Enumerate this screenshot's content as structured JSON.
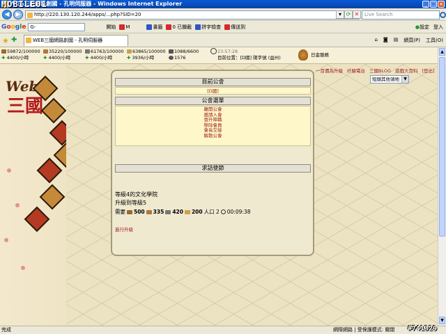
{
  "window": {
    "watermark": "MOBILE01",
    "title": "WEB三國網路創國 - 孔明伺服器 - Windows Internet Explorer"
  },
  "address_bar": {
    "url": "http://220.130.120.244/apps/...php?SID=20",
    "search_placeholder": "Live Search"
  },
  "google_toolbar": {
    "logo": "Google",
    "search_value": "G-",
    "items": [
      "開始",
      "M",
      "書籤",
      "0 已攔截",
      "拼字檢查",
      "傳送到"
    ],
    "right_items": [
      "設定",
      "登入"
    ]
  },
  "tabs": {
    "active": "WEB三國網路創國 - 孔明伺服器",
    "right_items": [
      "網頁(P)",
      "工具(O)"
    ]
  },
  "resources": [
    {
      "amount": "59872/100000",
      "rate": "4400/小時",
      "color": "#9a6a2a"
    },
    {
      "amount": "35220/100000",
      "rate": "4400/小時",
      "color": "#b0773a"
    },
    {
      "amount": "61763/100000",
      "rate": "4400/小時",
      "color": "#777777"
    },
    {
      "amount": "63865/100000",
      "rate": "3936/小時",
      "color": "#caa24a"
    },
    {
      "amount": "1088/6600",
      "rate": "1576",
      "color": "#555555"
    }
  ],
  "clock": {
    "time": "23:57:28",
    "location": "目前位置：[D國] 陽字號 (益州)"
  },
  "gold_label": "日金服務",
  "right_links": [
    "一百價為升級",
    "纤驗電台",
    "三國BLOG",
    "遊戲大百科",
    "[登出]"
  ],
  "region_select": "短頭其他領地",
  "panel": {
    "current_guild_header": "目前公會",
    "current_guild": "[D國]",
    "guild_menu_header": "公會選單",
    "guild_menu_items": [
      "離開公會",
      "邀請入會",
      "晉升降職",
      "移除會員",
      "會長交接",
      "解散公會"
    ],
    "envoy_header": "求詰使節",
    "building_name": "等級4的文化學院",
    "upgrade_target": "升級到等級5",
    "cost_label": "需要",
    "costs": [
      {
        "value": "500",
        "color": "#9a6a2a"
      },
      {
        "value": "335",
        "color": "#b0773a"
      },
      {
        "value": "420",
        "color": "#777777"
      },
      {
        "value": "200",
        "color": "#caa24a"
      }
    ],
    "population": "人口 2",
    "duration": "00:09:38",
    "upgrade_link": "進行升級"
  },
  "status_bar": {
    "left": "完成",
    "zone": "網際網路 | 受保護模式: 關閉",
    "code": "#741329"
  }
}
